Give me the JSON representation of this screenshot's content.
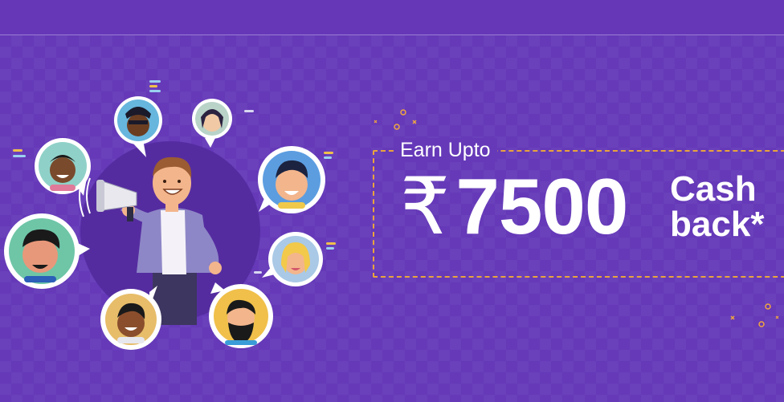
{
  "offer": {
    "earn_label": "Earn Upto",
    "currency_symbol": "₹",
    "amount": "7500",
    "cashback_line1": "Cash",
    "cashback_line2": "back*"
  },
  "colors": {
    "background": "#6539b8",
    "dashed_border": "#e9a43c",
    "text": "#ffffff"
  },
  "illustration": {
    "center": "man-with-megaphone",
    "avatars": [
      "person-1",
      "person-2",
      "person-3",
      "person-4",
      "person-5",
      "person-6",
      "person-7",
      "person-8"
    ]
  }
}
